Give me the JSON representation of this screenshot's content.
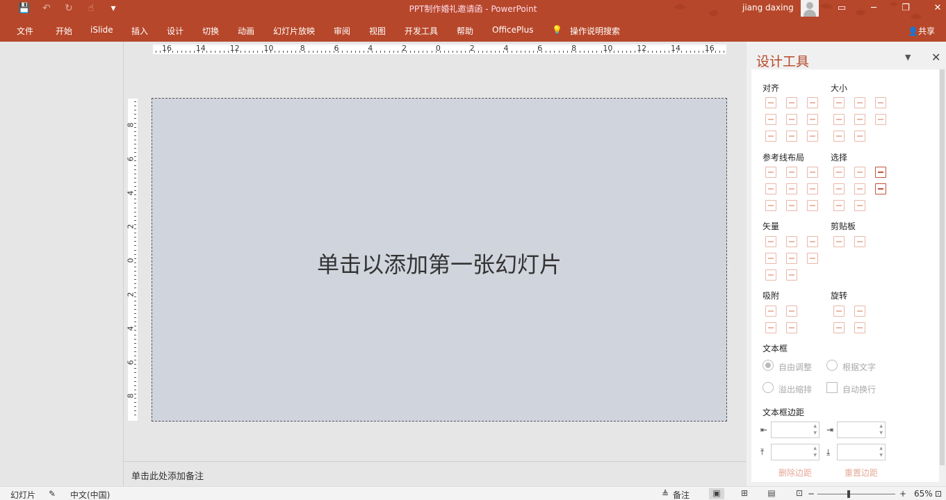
{
  "window": {
    "title": "PPT制作婚礼邀请函  -  PowerPoint",
    "user": "jiang daxing"
  },
  "qat": {
    "save_icon": "💾",
    "undo_icon": "↶",
    "redo_icon": "↻",
    "touch_icon": "☝",
    "more_icon": "▾"
  },
  "ribbon": {
    "tabs": [
      "文件",
      "开始",
      "iSlide",
      "插入",
      "设计",
      "切换",
      "动画",
      "幻灯片放映",
      "审阅",
      "视图",
      "开发工具",
      "帮助",
      "OfficePlus"
    ],
    "tell_me": "操作说明搜索",
    "share": "共享"
  },
  "rulers": {
    "horizontal": [
      "16",
      "14",
      "12",
      "10",
      "8",
      "6",
      "4",
      "2",
      "0",
      "2",
      "4",
      "6",
      "8",
      "10",
      "12",
      "14",
      "16"
    ],
    "vertical": [
      "8",
      "6",
      "4",
      "2",
      "0",
      "2",
      "4",
      "6",
      "8"
    ]
  },
  "slide": {
    "placeholder": "单击以添加第一张幻灯片"
  },
  "notes": {
    "placeholder": "单击此处添加备注"
  },
  "panel": {
    "title": "设计工具",
    "sections": {
      "align": "对齐",
      "size": "大小",
      "guides": "参考线布局",
      "select": "选择",
      "vector": "矢量",
      "clipboard": "剪贴板",
      "snap": "吸附",
      "rotate": "旋转",
      "textbox": "文本框",
      "margins": "文本框边距"
    },
    "textbox_options": {
      "auto_fit": "自由调整",
      "fit_text": "根据文字",
      "shrink": "溢出缩排",
      "wrap": "自动换行"
    },
    "margin_buttons": {
      "delete": "删除边距",
      "reset": "重置边距"
    }
  },
  "status": {
    "slides": "幻灯片",
    "language": "中文(中国)",
    "notes": "备注",
    "zoom": "65%"
  }
}
